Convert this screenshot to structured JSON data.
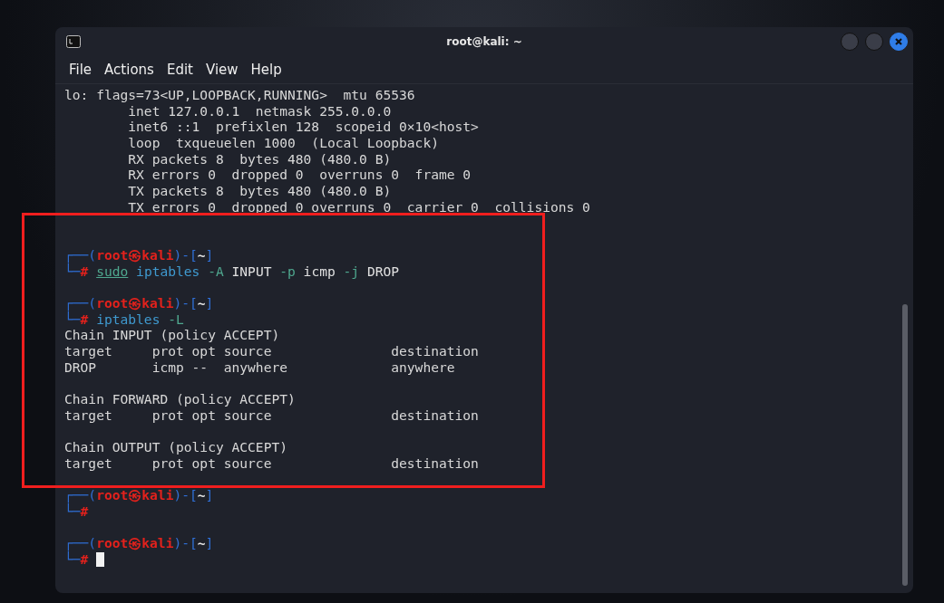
{
  "window": {
    "title": "root@kali: ~"
  },
  "menu": [
    "File",
    "Actions",
    "Edit",
    "View",
    "Help"
  ],
  "terminal": {
    "lines": [
      {
        "kind": "output",
        "text": "lo: flags=73<UP,LOOPBACK,RUNNING>  mtu 65536"
      },
      {
        "kind": "output",
        "text": "        inet 127.0.0.1  netmask 255.0.0.0"
      },
      {
        "kind": "output",
        "text": "        inet6 ::1  prefixlen 128  scopeid 0×10<host>"
      },
      {
        "kind": "output",
        "text": "        loop  txqueuelen 1000  (Local Loopback)"
      },
      {
        "kind": "output",
        "text": "        RX packets 8  bytes 480 (480.0 B)"
      },
      {
        "kind": "output",
        "text": "        RX errors 0  dropped 0  overruns 0  frame 0"
      },
      {
        "kind": "output",
        "text": "        TX packets 8  bytes 480 (480.0 B)"
      },
      {
        "kind": "output",
        "text": "        TX errors 0  dropped 0 overruns 0  carrier 0  collisions 0"
      },
      {
        "kind": "blank"
      },
      {
        "kind": "blank"
      },
      {
        "kind": "prompt",
        "open": "┌──(",
        "user": "root",
        "symbol": "㉿",
        "host": "kali",
        "mid": ")-[",
        "dir": "~",
        "close": "]",
        "corner": "└─",
        "hash": "#",
        "command": [
          {
            "kind": "sudo",
            "text": "sudo"
          },
          {
            "kind": "program",
            "text": "iptables"
          },
          {
            "kind": "flag",
            "text": "-A"
          },
          {
            "kind": "arg",
            "text": "INPUT"
          },
          {
            "kind": "flag",
            "text": "-p"
          },
          {
            "kind": "arg",
            "text": "icmp"
          },
          {
            "kind": "flag",
            "text": "-j"
          },
          {
            "kind": "arg",
            "text": "DROP"
          }
        ]
      },
      {
        "kind": "blank"
      },
      {
        "kind": "prompt",
        "open": "┌──(",
        "user": "root",
        "symbol": "㉿",
        "host": "kali",
        "mid": ")-[",
        "dir": "~",
        "close": "]",
        "corner": "└─",
        "hash": "#",
        "command": [
          {
            "kind": "program",
            "text": "iptables"
          },
          {
            "kind": "flag",
            "text": "-L"
          }
        ]
      },
      {
        "kind": "output",
        "text": "Chain INPUT (policy ACCEPT)"
      },
      {
        "kind": "output",
        "text": "target     prot opt source               destination"
      },
      {
        "kind": "output",
        "text": "DROP       icmp --  anywhere             anywhere"
      },
      {
        "kind": "blank"
      },
      {
        "kind": "output",
        "text": "Chain FORWARD (policy ACCEPT)"
      },
      {
        "kind": "output",
        "text": "target     prot opt source               destination"
      },
      {
        "kind": "blank"
      },
      {
        "kind": "output",
        "text": "Chain OUTPUT (policy ACCEPT)"
      },
      {
        "kind": "output",
        "text": "target     prot opt source               destination"
      },
      {
        "kind": "blank"
      },
      {
        "kind": "prompt",
        "open": "┌──(",
        "user": "root",
        "symbol": "㉿",
        "host": "kali",
        "mid": ")-[",
        "dir": "~",
        "close": "]",
        "corner": "└─",
        "hash": "#"
      },
      {
        "kind": "blank"
      },
      {
        "kind": "prompt",
        "open": "┌──(",
        "user": "root",
        "symbol": "㉿",
        "host": "kali",
        "mid": ")-[",
        "dir": "~",
        "close": "]",
        "corner": "└─",
        "hash": "#",
        "cursor": true
      }
    ]
  }
}
